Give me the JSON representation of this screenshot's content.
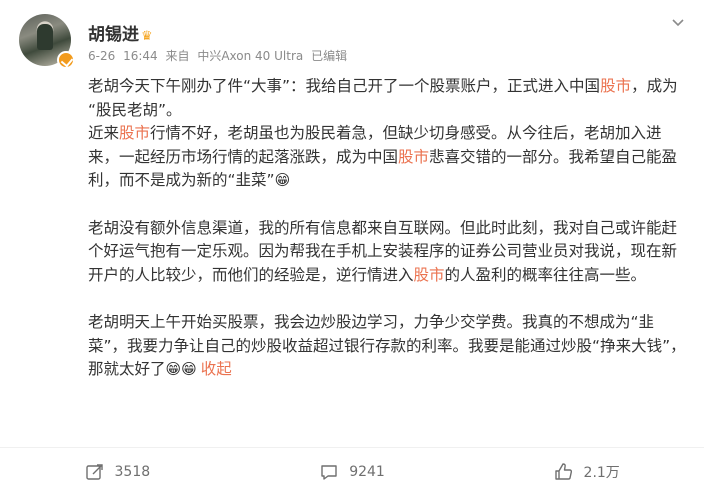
{
  "user": {
    "name": "胡锡进",
    "vip_icon": "crown-icon",
    "verified_icon": "verified-badge-icon",
    "verified_color": "#f29b1d"
  },
  "meta": {
    "date": "6-26",
    "time": "16:44",
    "source_prefix": "来自",
    "device": "中兴Axon 40 Ultra",
    "edited": "已编辑"
  },
  "post": {
    "paragraphs": [
      [
        {
          "text": "老胡今天下午刚办了件“大事”：我给自己开了一个股票账户，正式进入中国",
          "kw": false
        },
        {
          "text": "股市",
          "kw": true
        },
        {
          "text": "，成为 “股民老胡”。",
          "kw": false
        }
      ],
      [
        {
          "text": "近来",
          "kw": false
        },
        {
          "text": "股市",
          "kw": true
        },
        {
          "text": "行情不好，老胡虽也为股民着急，但缺少切身感受。从今往后，老胡加入进来，一起经历市场行情的起落涨跌，成为中国",
          "kw": false
        },
        {
          "text": "股市",
          "kw": true
        },
        {
          "text": "悲喜交错的一部分。我希望自己能盈利，而不是成为新的“韭菜”",
          "kw": false
        },
        {
          "emoji": "😁"
        }
      ],
      [],
      [
        {
          "text": "老胡没有额外信息渠道，我的所有信息都来自互联网。但此时此刻，我对自己或许能赶个好运气抱有一定乐观。因为帮我在手机上安装程序的证券公司营业员对我说，现在新开户的人比较少，而他们的经验是，逆行情进入",
          "kw": false
        },
        {
          "text": "股市",
          "kw": true
        },
        {
          "text": "的人盈利的概率往往高一些。",
          "kw": false
        }
      ],
      [],
      [
        {
          "text": "老胡明天上午开始买股票，我会边炒股边学习，力争少交学费。我真的不想成为“韭菜”，我要力争让自己的炒股收益超过银行存款的利率。我要是能通过炒股“挣来大钱”，那就太好了",
          "kw": false
        },
        {
          "emoji": "😁"
        },
        {
          "emoji": "😁"
        }
      ]
    ],
    "collapse_label": "收起",
    "keyword_color": "#eb7350"
  },
  "actions": {
    "share": {
      "icon": "share-icon",
      "count": "3518"
    },
    "comment": {
      "icon": "comment-icon",
      "count": "9241"
    },
    "like": {
      "icon": "thumbs-up-icon",
      "count": "2.1万"
    }
  }
}
